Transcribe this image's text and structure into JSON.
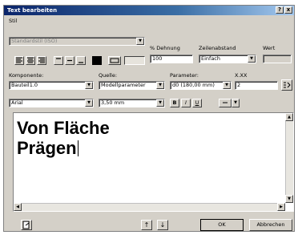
{
  "window": {
    "title": "Text bearbeiten",
    "help_btn": "?",
    "close_btn": "x"
  },
  "stil": {
    "label": "Stil",
    "value": "Standardstil (ISO)"
  },
  "dehnung": {
    "label": "% Dehnung",
    "value": "100"
  },
  "zeilenabstand": {
    "label": "Zeilenabstand",
    "value": "Einfach"
  },
  "wert": {
    "label": "Wert",
    "value": ""
  },
  "komponente": {
    "label": "Komponente:",
    "value": "Bauteil1.0"
  },
  "quelle": {
    "label": "Quelle:",
    "value": "Modellparameter"
  },
  "parameter": {
    "label": "Parameter:",
    "value": "d0 (180,00 mm)"
  },
  "xx": {
    "label": "X.XX",
    "value": "2"
  },
  "font": {
    "value": "Arial"
  },
  "size": {
    "value": "3,50 mm"
  },
  "format": {
    "bold": "B",
    "italic": "I",
    "underline": "U"
  },
  "editor": {
    "line1": "Von Fläche",
    "line2": "Prägen"
  },
  "buttons": {
    "ok": "OK",
    "cancel": "Abbrechen",
    "up": "↑",
    "down": "↓"
  },
  "colors": {
    "titlebar": "#0a246a",
    "face": "#d4d0c8"
  }
}
